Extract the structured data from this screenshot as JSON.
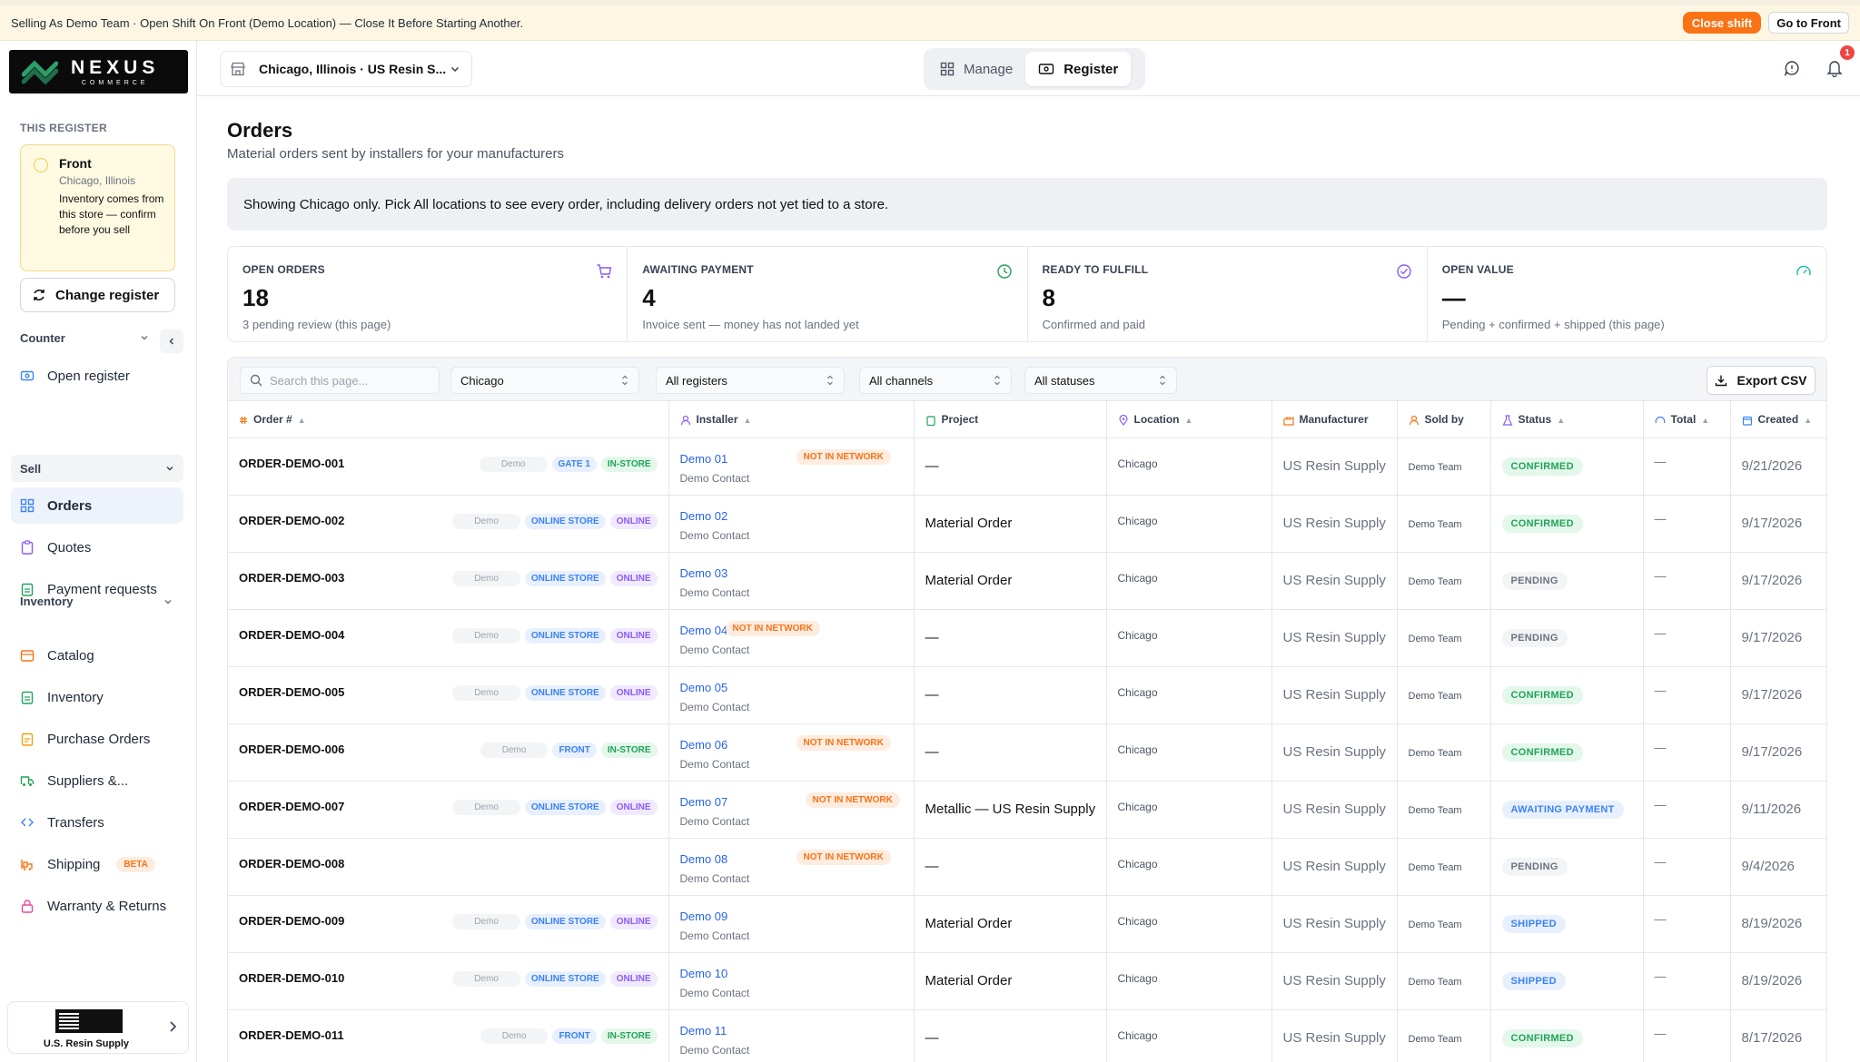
{
  "banner": {
    "text": "Selling As Demo Team · Open Shift On Front (Demo Location) — Close It Before Starting Another.",
    "close_shift_label": "Close shift",
    "go_to_label": "Go to Front"
  },
  "brand": {
    "name": "NEXUS",
    "tagline": "COMMERCE"
  },
  "sidebar": {
    "this_register_label": "THIS REGISTER",
    "register": {
      "name": "Front",
      "location": "Chicago, Illinois",
      "note": "Inventory comes from this store — confirm before you sell"
    },
    "change_register_label": "Change register",
    "counter_label": "Counter",
    "open_register_label": "Open register",
    "sell_label": "Sell",
    "sell_items": [
      "Orders",
      "Quotes",
      "Payment requests"
    ],
    "inventory_label": "Inventory",
    "inventory_items": [
      "Catalog",
      "Inventory",
      "Purchase Orders",
      "Suppliers &...",
      "Transfers",
      "Shipping",
      "Warranty & Returns"
    ],
    "beta_label": "BETA",
    "store_name": "U.S. Resin Supply"
  },
  "header": {
    "location": "Chicago, Illinois · US Resin S...",
    "manage_label": "Manage",
    "register_label": "Register",
    "notification_count": "1"
  },
  "page": {
    "title": "Orders",
    "subtitle": "Material orders sent by installers for your manufacturers",
    "info": "Showing Chicago only. Pick All locations to see every order, including delivery orders not yet tied to a store."
  },
  "stats": [
    {
      "label": "OPEN ORDERS",
      "value": "18",
      "note": "3 pending review (this page)",
      "icon": "cart-icon",
      "color": "#8b5cf6"
    },
    {
      "label": "AWAITING PAYMENT",
      "value": "4",
      "note": "Invoice sent — money has not landed yet",
      "icon": "clock-icon",
      "color": "#22a35a"
    },
    {
      "label": "READY TO FULFILL",
      "value": "8",
      "note": "Confirmed and paid",
      "icon": "check-circle-icon",
      "color": "#8b5cf6"
    },
    {
      "label": "OPEN VALUE",
      "value": "—",
      "note": "Pending + confirmed + shipped (this page)",
      "icon": "gauge-icon",
      "color": "#14b8a6"
    }
  ],
  "toolbar": {
    "search_placeholder": "Search this page...",
    "location_filter": "Chicago",
    "register_filter": "All registers",
    "channel_filter": "All channels",
    "status_filter": "All statuses",
    "export_label": "Export CSV"
  },
  "table": {
    "columns": [
      "Order #",
      "Installer",
      "Project",
      "Location",
      "Manufacturer",
      "Sold by",
      "Status",
      "Total",
      "Created"
    ],
    "rows": [
      {
        "id": "ORDER-DEMO-001",
        "tags": [
          [
            "Demo",
            "demo"
          ],
          [
            "GATE 1",
            "blue"
          ],
          [
            "IN-STORE",
            "green"
          ]
        ],
        "installer": "Demo 01",
        "contact": "Demo Contact",
        "nin": true,
        "project": "—",
        "location": "Chicago",
        "manufacturer": "US Resin Supply",
        "sold_by": "Demo Team",
        "status": "CONFIRMED",
        "total": "—",
        "created": "9/21/2026"
      },
      {
        "id": "ORDER-DEMO-002",
        "tags": [
          [
            "Demo",
            "demo"
          ],
          [
            "ONLINE STORE",
            "blue"
          ],
          [
            "ONLINE",
            "purple"
          ]
        ],
        "installer": "Demo 02",
        "contact": "Demo Contact",
        "nin": false,
        "project": "Material Order",
        "location": "Chicago",
        "manufacturer": "US Resin Supply",
        "sold_by": "Demo Team",
        "status": "CONFIRMED",
        "total": "—",
        "created": "9/17/2026"
      },
      {
        "id": "ORDER-DEMO-003",
        "tags": [
          [
            "Demo",
            "demo"
          ],
          [
            "ONLINE STORE",
            "blue"
          ],
          [
            "ONLINE",
            "purple"
          ]
        ],
        "installer": "Demo 03",
        "contact": "Demo Contact",
        "nin": false,
        "project": "Material Order",
        "location": "Chicago",
        "manufacturer": "US Resin Supply",
        "sold_by": "Demo Team",
        "status": "PENDING",
        "total": "—",
        "created": "9/17/2026"
      },
      {
        "id": "ORDER-DEMO-004",
        "tags": [
          [
            "Demo",
            "demo"
          ],
          [
            "ONLINE STORE",
            "blue"
          ],
          [
            "ONLINE",
            "purple"
          ]
        ],
        "installer": "Demo 04",
        "contact": "Demo Contact",
        "nin": true,
        "project": "—",
        "location": "Chicago",
        "manufacturer": "US Resin Supply",
        "sold_by": "Demo Team",
        "status": "PENDING",
        "total": "—",
        "created": "9/17/2026"
      },
      {
        "id": "ORDER-DEMO-005",
        "tags": [
          [
            "Demo",
            "demo"
          ],
          [
            "ONLINE STORE",
            "blue"
          ],
          [
            "ONLINE",
            "purple"
          ]
        ],
        "installer": "Demo 05",
        "contact": "Demo Contact",
        "nin": false,
        "project": "—",
        "location": "Chicago",
        "manufacturer": "US Resin Supply",
        "sold_by": "Demo Team",
        "status": "CONFIRMED",
        "total": "—",
        "created": "9/17/2026"
      },
      {
        "id": "ORDER-DEMO-006",
        "tags": [
          [
            "Demo",
            "demo"
          ],
          [
            "FRONT",
            "blue"
          ],
          [
            "IN-STORE",
            "green"
          ]
        ],
        "installer": "Demo 06",
        "contact": "Demo Contact",
        "nin": true,
        "project": "—",
        "location": "Chicago",
        "manufacturer": "US Resin Supply",
        "sold_by": "Demo Team",
        "status": "CONFIRMED",
        "total": "—",
        "created": "9/17/2026"
      },
      {
        "id": "ORDER-DEMO-007",
        "tags": [
          [
            "Demo",
            "demo"
          ],
          [
            "ONLINE STORE",
            "blue"
          ],
          [
            "ONLINE",
            "purple"
          ]
        ],
        "installer": "Demo 07",
        "contact": "Demo Contact",
        "nin": true,
        "project": "Metallic — US Resin Supply",
        "location": "Chicago",
        "manufacturer": "US Resin Supply",
        "sold_by": "Demo Team",
        "status": "AWAITING PAYMENT",
        "total": "—",
        "created": "9/11/2026"
      },
      {
        "id": "ORDER-DEMO-008",
        "tags": [],
        "installer": "Demo 08",
        "contact": "Demo Contact",
        "nin": true,
        "project": "—",
        "location": "Chicago",
        "manufacturer": "US Resin Supply",
        "sold_by": "Demo Team",
        "status": "PENDING",
        "total": "—",
        "created": "9/4/2026"
      },
      {
        "id": "ORDER-DEMO-009",
        "tags": [
          [
            "Demo",
            "demo"
          ],
          [
            "ONLINE STORE",
            "blue"
          ],
          [
            "ONLINE",
            "purple"
          ]
        ],
        "installer": "Demo 09",
        "contact": "Demo Contact",
        "nin": false,
        "project": "Material Order",
        "location": "Chicago",
        "manufacturer": "US Resin Supply",
        "sold_by": "Demo Team",
        "status": "SHIPPED",
        "total": "—",
        "created": "8/19/2026"
      },
      {
        "id": "ORDER-DEMO-010",
        "tags": [
          [
            "Demo",
            "demo"
          ],
          [
            "ONLINE STORE",
            "blue"
          ],
          [
            "ONLINE",
            "purple"
          ]
        ],
        "installer": "Demo 10",
        "contact": "Demo Contact",
        "nin": false,
        "project": "Material Order",
        "location": "Chicago",
        "manufacturer": "US Resin Supply",
        "sold_by": "Demo Team",
        "status": "SHIPPED",
        "total": "—",
        "created": "8/19/2026"
      },
      {
        "id": "ORDER-DEMO-011",
        "tags": [
          [
            "Demo",
            "demo"
          ],
          [
            "FRONT",
            "blue"
          ],
          [
            "IN-STORE",
            "green"
          ]
        ],
        "installer": "Demo 11",
        "contact": "Demo Contact",
        "nin": false,
        "project": "—",
        "location": "Chicago",
        "manufacturer": "US Resin Supply",
        "sold_by": "Demo Team",
        "status": "CONFIRMED",
        "total": "—",
        "created": "8/17/2026"
      }
    ],
    "not_in_network_label": "NOT IN NETWORK"
  }
}
